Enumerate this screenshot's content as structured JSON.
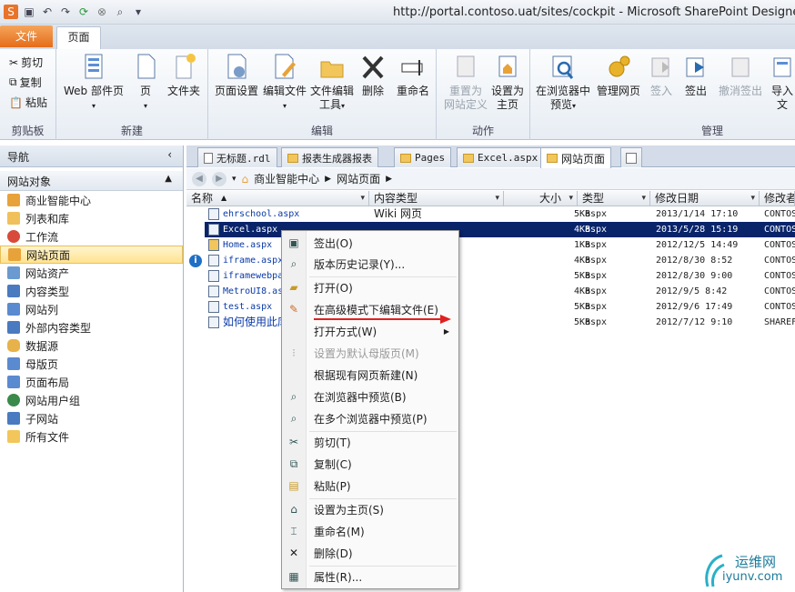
{
  "window": {
    "title": "http://portal.contoso.uat/sites/cockpit - Microsoft SharePoint Designer"
  },
  "ribbon_tabs": {
    "file": "文件",
    "page": "页面"
  },
  "ribbon": {
    "clipboard": {
      "label": "剪贴板",
      "cut": "剪切",
      "copy": "复制",
      "paste": "粘贴"
    },
    "new": {
      "label": "新建",
      "webpart_page": "Web 部件页",
      "page": "页",
      "folder": "文件夹"
    },
    "edit": {
      "label": "编辑",
      "page_settings": "页面设置",
      "edit_file": "编辑文件",
      "edit_file_tools_1": "文件编辑",
      "edit_file_tools_2": "工具",
      "delete": "删除",
      "rename": "重命名"
    },
    "action": {
      "label": "动作",
      "reset_1": "重置为",
      "reset_2": "网站定义",
      "set_home_1": "设置为",
      "set_home_2": "主页"
    },
    "manage": {
      "label": "管理",
      "preview_1": "在浏览器中",
      "preview_2": "预览",
      "manage_pages": "管理网页",
      "check_in": "签入",
      "check_out": "签出",
      "undo_checkout": "撤消签出",
      "import": "导入文"
    }
  },
  "nav": {
    "title": "导航",
    "section": "网站对象",
    "items": [
      "商业智能中心",
      "列表和库",
      "工作流",
      "网站页面",
      "网站资产",
      "内容类型",
      "网站列",
      "外部内容类型",
      "数据源",
      "母版页",
      "页面布局",
      "网站用户组",
      "子网站",
      "所有文件"
    ]
  },
  "doc_tabs": [
    "无标题.rdl",
    "报表生成器报表",
    "Pages",
    "Excel.aspx",
    "网站页面"
  ],
  "breadcrumb": {
    "root": "商业智能中心",
    "current": "网站页面"
  },
  "columns": {
    "name": "名称",
    "content_type": "内容类型",
    "size": "大小",
    "type": "类型",
    "modified": "修改日期",
    "modified_by": "修改者"
  },
  "files": [
    {
      "name": "ehrschool.aspx",
      "content_type": "Wiki 网页",
      "size": "5KB",
      "type": "aspx",
      "date": "2013/1/14 17:10",
      "by": "CONTOS"
    },
    {
      "name": "Excel.aspx",
      "content_type": "",
      "size": "4KB",
      "type": "aspx",
      "date": "2013/5/28 15:19",
      "by": "CONTOS"
    },
    {
      "name": "Home.aspx",
      "content_type": "",
      "size": "1KB",
      "type": "aspx",
      "date": "2012/12/5 14:49",
      "by": "CONTOS"
    },
    {
      "name": "iframe.aspx",
      "content_type": "",
      "size": "4KB",
      "type": "aspx",
      "date": "2012/8/30 8:52",
      "by": "CONTOS"
    },
    {
      "name": "iframewebpa",
      "content_type": "",
      "size": "5KB",
      "type": "aspx",
      "date": "2012/8/30 9:00",
      "by": "CONTOS"
    },
    {
      "name": "MetroUI8.as",
      "content_type": "",
      "size": "4KB",
      "type": "aspx",
      "date": "2012/9/5 8:42",
      "by": "CONTOS"
    },
    {
      "name": "test.aspx",
      "content_type": "",
      "size": "5KB",
      "type": "aspx",
      "date": "2012/9/6 17:49",
      "by": "CONTOS"
    },
    {
      "name": "如何使用此库",
      "content_type": "",
      "size": "5KB",
      "type": "aspx",
      "date": "2012/7/12 9:10",
      "by": "SHAREF"
    }
  ],
  "context_menu": {
    "checkout": "签出(O)",
    "history": "版本历史记录(Y)...",
    "open": "打开(O)",
    "advanced_edit": "在高级模式下编辑文件(E)",
    "open_with": "打开方式(W)",
    "set_default_master": "设置为默认母版页(M)",
    "new_from_existing": "根据现有网页新建(N)",
    "preview": "在浏览器中预览(B)",
    "preview_multi": "在多个浏览器中预览(P)",
    "cut": "剪切(T)",
    "copy": "复制(C)",
    "paste": "粘贴(P)",
    "set_home": "设置为主页(S)",
    "rename": "重命名(M)",
    "delete": "删除(D)",
    "properties": "属性(R)..."
  },
  "watermark": {
    "line1": "运维网",
    "line2": "iyunv.com"
  }
}
